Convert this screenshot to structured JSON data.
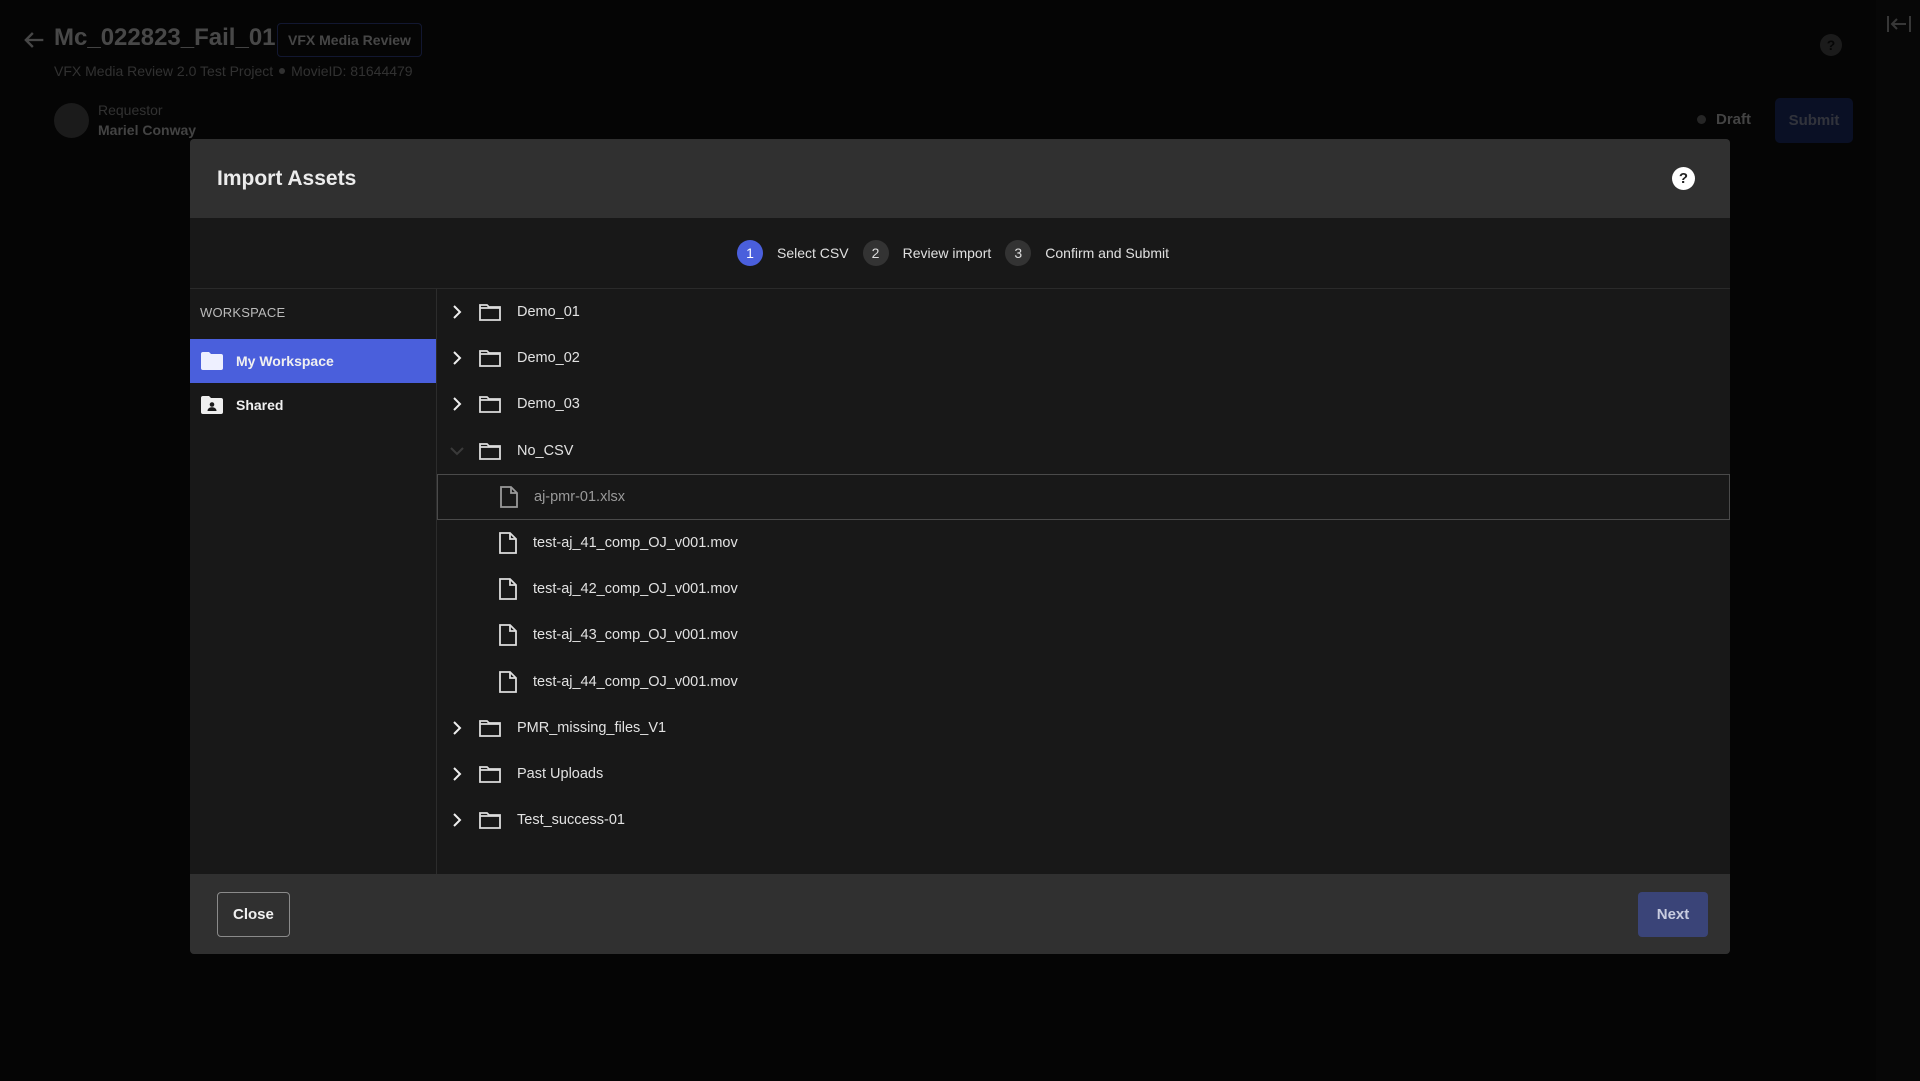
{
  "page": {
    "title": "Mc_022823_Fail_01",
    "type_badge": "VFX Media Review",
    "project": "VFX Media Review 2.0 Test Project",
    "movie_id": "MovieID: 81644479",
    "requestor_label": "Requestor",
    "requestor_name": "Mariel Conway",
    "status": "Draft",
    "submit_label": "Submit",
    "help_glyph": "?",
    "collapse_glyph": "|←|"
  },
  "modal": {
    "title": "Import Assets",
    "help_glyph": "?",
    "steps": [
      {
        "num": "1",
        "label": "Select CSV",
        "active": true
      },
      {
        "num": "2",
        "label": "Review import",
        "active": false
      },
      {
        "num": "3",
        "label": "Confirm and Submit",
        "active": false
      }
    ],
    "sidebar": {
      "heading": "WORKSPACE",
      "items": [
        {
          "label": "My Workspace",
          "icon": "folder-icon",
          "selected": true
        },
        {
          "label": "Shared",
          "icon": "shared-folder-icon",
          "selected": false
        }
      ]
    },
    "tree": [
      {
        "type": "folder",
        "name": "Demo_01",
        "expanded": false
      },
      {
        "type": "folder",
        "name": "Demo_02",
        "expanded": false
      },
      {
        "type": "folder",
        "name": "Demo_03",
        "expanded": false
      },
      {
        "type": "folder",
        "name": "No_CSV",
        "expanded": true
      },
      {
        "type": "file",
        "name": "aj-pmr-01.xlsx",
        "disabled": true,
        "highlighted": true
      },
      {
        "type": "file",
        "name": "test-aj_41_comp_OJ_v001.mov"
      },
      {
        "type": "file",
        "name": "test-aj_42_comp_OJ_v001.mov"
      },
      {
        "type": "file",
        "name": "test-aj_43_comp_OJ_v001.mov"
      },
      {
        "type": "file",
        "name": "test-aj_44_comp_OJ_v001.mov"
      },
      {
        "type": "folder",
        "name": "PMR_missing_files_V1",
        "expanded": false
      },
      {
        "type": "folder",
        "name": "Past Uploads",
        "expanded": false
      },
      {
        "type": "folder",
        "name": "Test_success-01",
        "expanded": false
      }
    ],
    "footer": {
      "close_label": "Close",
      "next_label": "Next"
    }
  },
  "colors": {
    "accent": "#4a5fdc",
    "next_button": "#3a4478",
    "modal_header": "#303030",
    "modal_body": "#181818"
  }
}
